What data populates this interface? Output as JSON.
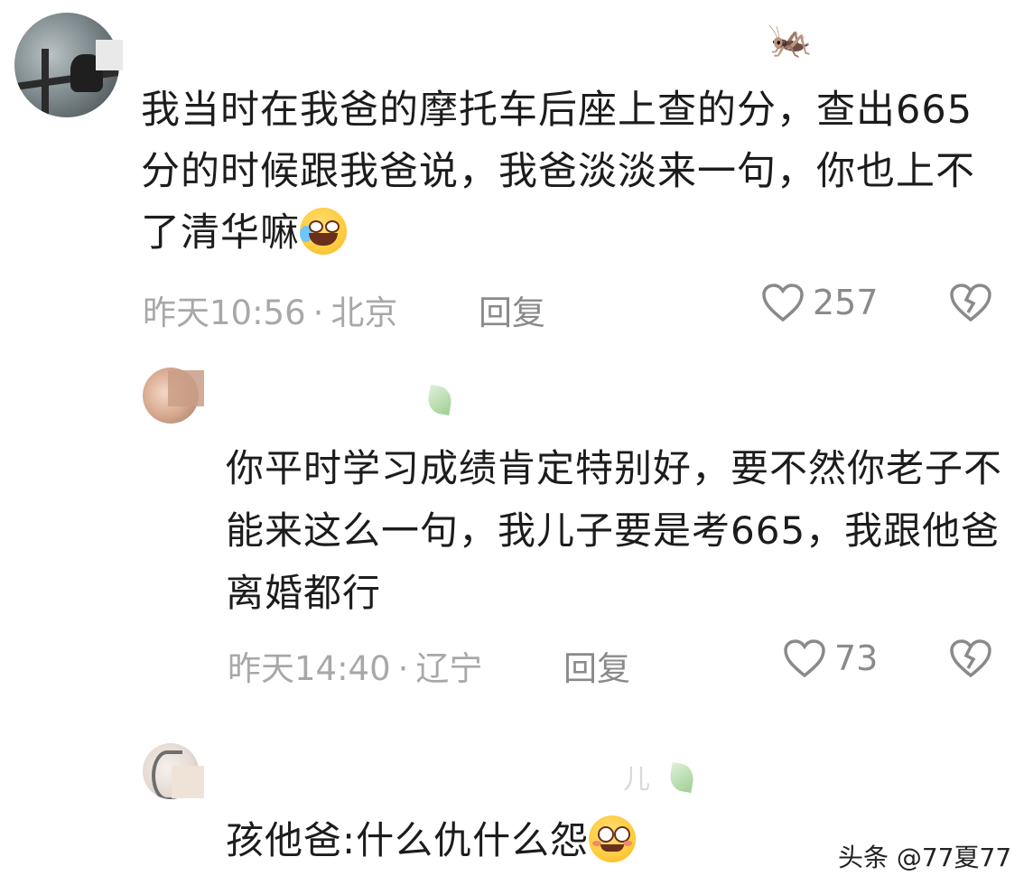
{
  "comments": [
    {
      "text": "我当时在我爸的摩托车后座上查的分，查出665分的时候跟我爸说，我爸淡淡来一句，你也上不了清华嘛",
      "emoji": "rofl-emoji",
      "time": "昨天10:56",
      "separator": "·",
      "location": "北京",
      "reply_label": "回复",
      "likes": "257"
    },
    {
      "text": "你平时学习成绩肯定特别好，要不然你老子不能来这么一句，我儿子要是考665，我跟他爸离婚都行",
      "time": "昨天14:40",
      "separator": "·",
      "location": "辽宁",
      "reply_label": "回复",
      "likes": "73"
    },
    {
      "username_fragment": "儿",
      "text": "孩他爸:什么仇什么怨",
      "emoji": "blush-smile-emoji"
    }
  ],
  "watermark": "头条 @77夏77",
  "colors": {
    "meta_gray": "#a8a8a8",
    "icon_gray": "#8a8a8a",
    "text": "#1c1c1c"
  }
}
